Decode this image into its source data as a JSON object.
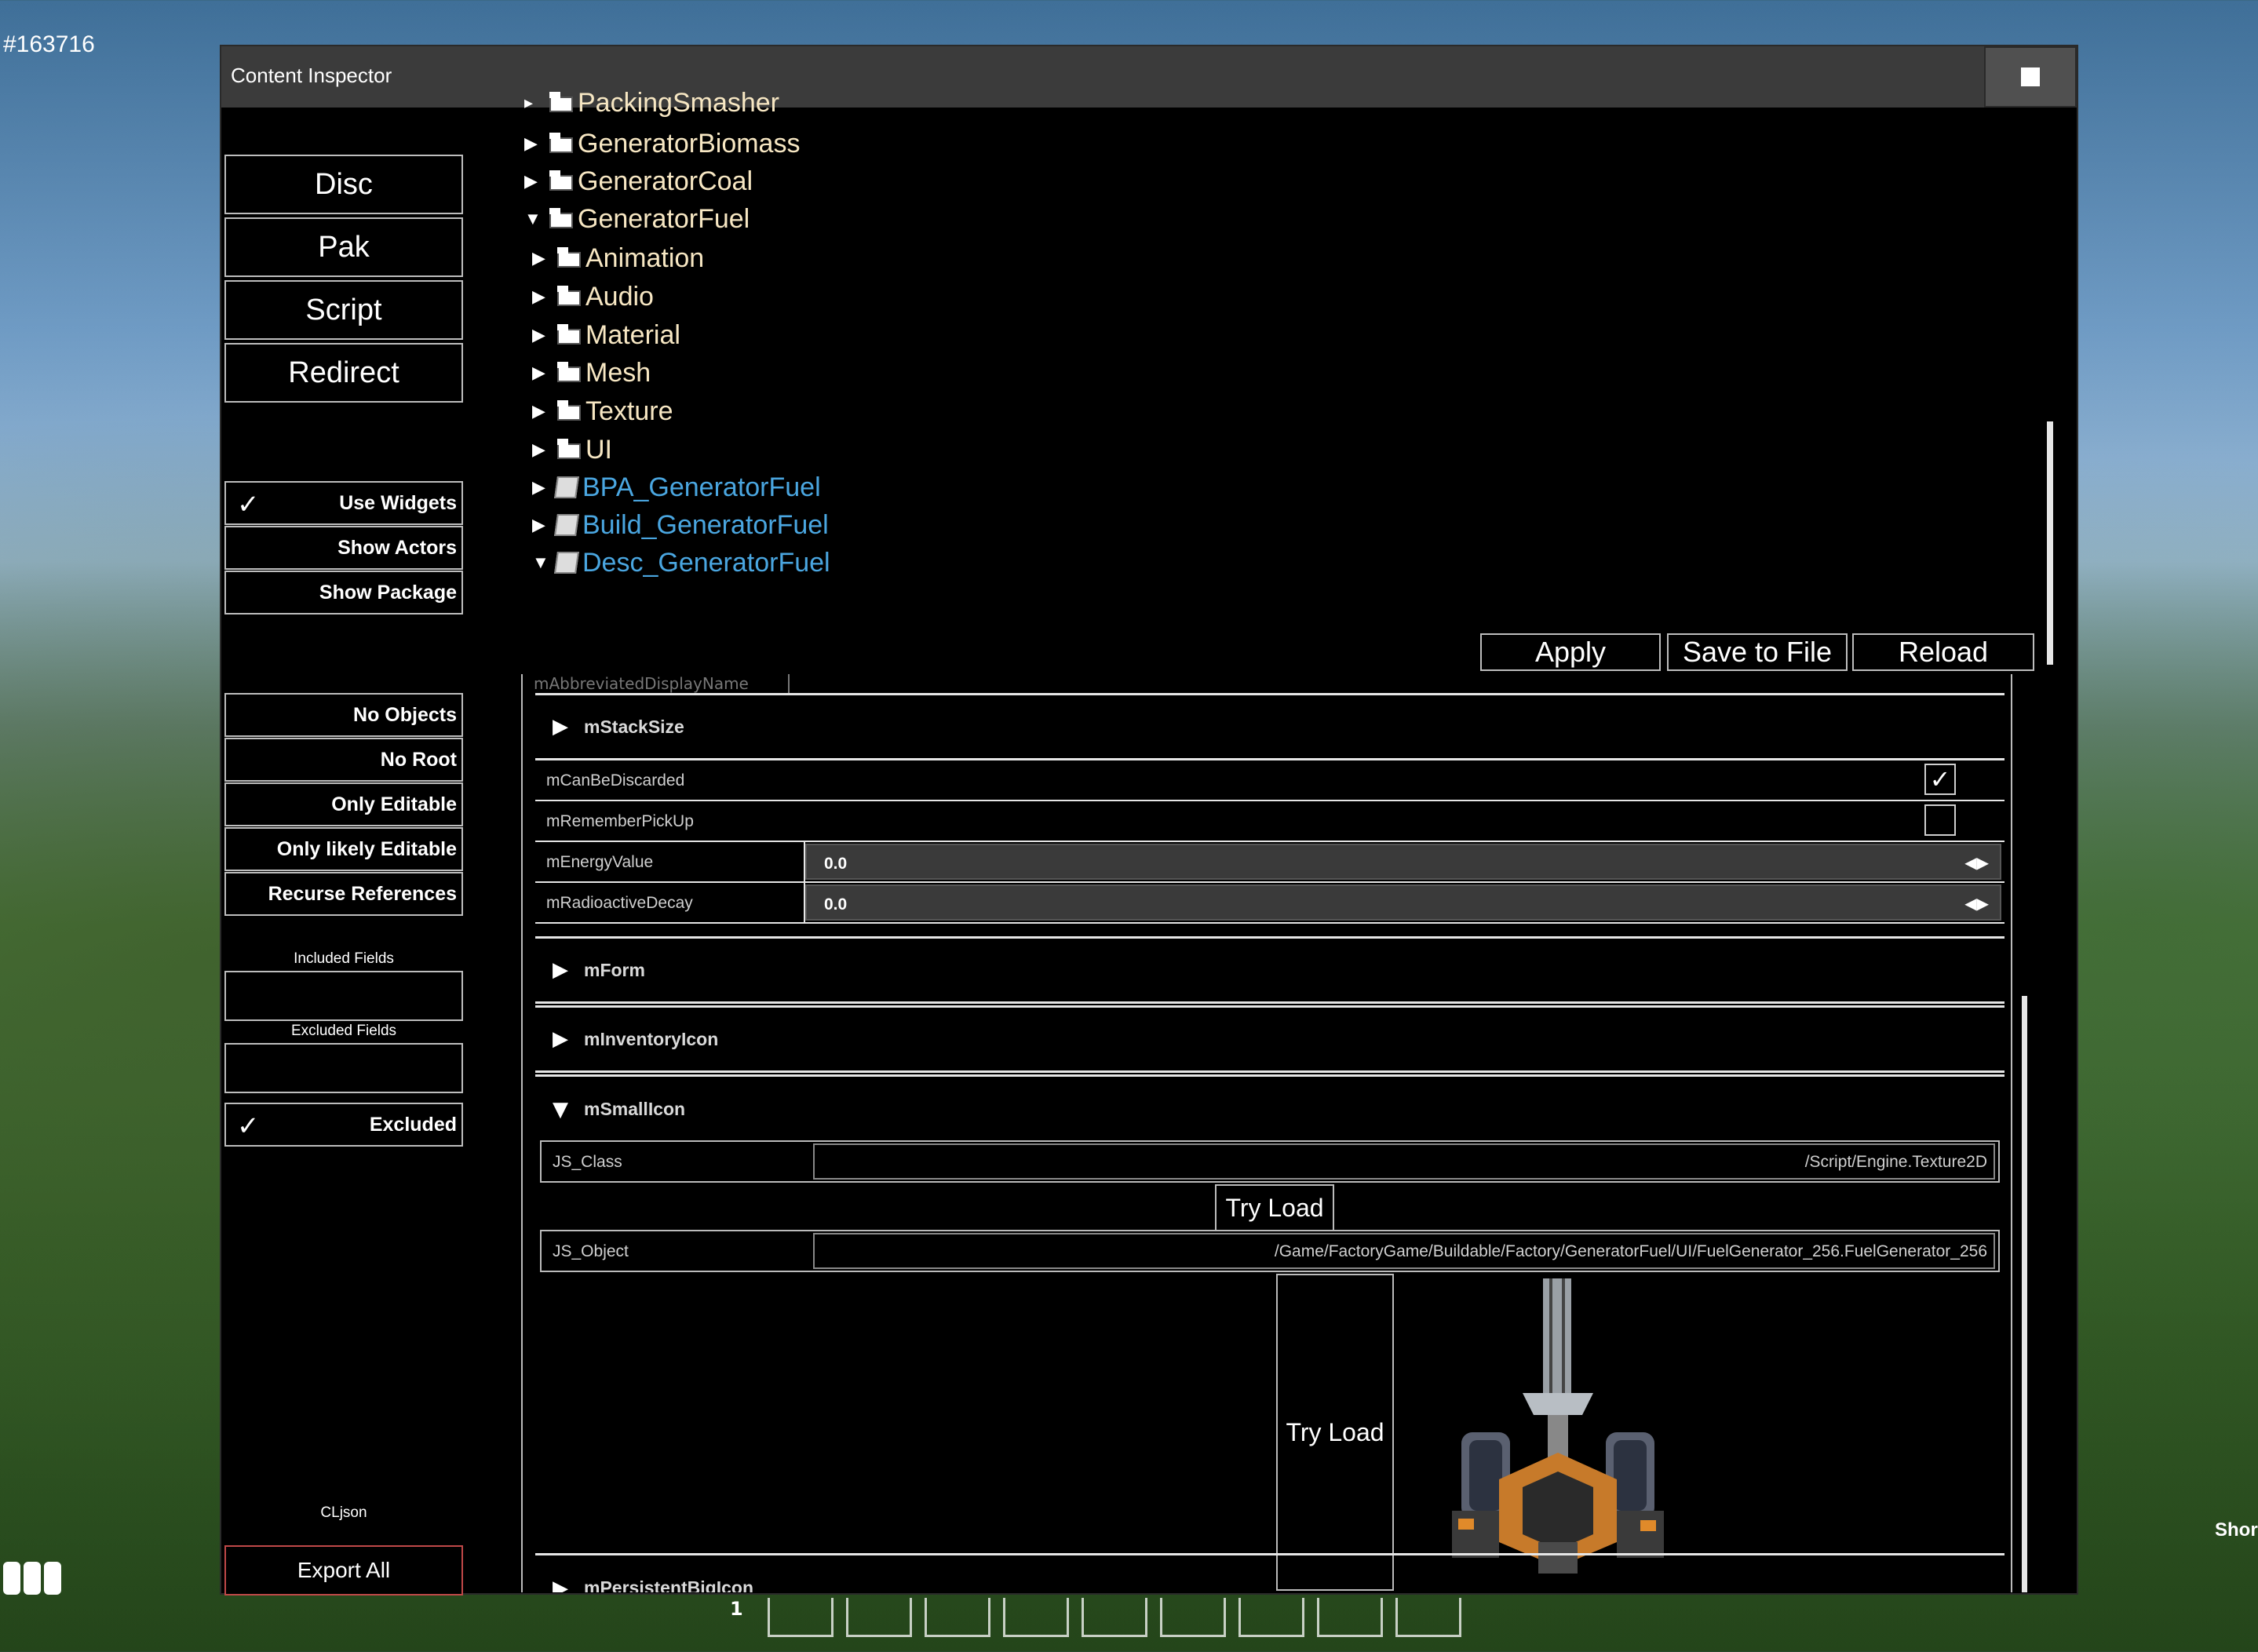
{
  "corner_id": "#163716",
  "window": {
    "title": "Content Inspector"
  },
  "sidebar": {
    "modes": [
      "Disc",
      "Pak",
      "Script",
      "Redirect"
    ],
    "toggles": [
      {
        "label": "Use Widgets",
        "checked": true
      },
      {
        "label": "Show Actors",
        "checked": false
      },
      {
        "label": "Show Package",
        "checked": false
      }
    ],
    "filters": [
      {
        "label": "No Objects"
      },
      {
        "label": "No Root"
      },
      {
        "label": "Only Editable"
      },
      {
        "label": "Only likely Editable"
      },
      {
        "label": "Recurse References"
      }
    ],
    "included_fields_label": "Included Fields",
    "excluded_fields_label": "Excluded Fields",
    "excluded_toggle": {
      "label": "Excluded",
      "checked": true
    },
    "format_label": "CLjson",
    "export_label": "Export All"
  },
  "tree": {
    "cut_item": "PackingSmasher",
    "items": [
      {
        "name": "GeneratorBiomass",
        "type": "folder",
        "expanded": false
      },
      {
        "name": "GeneratorCoal",
        "type": "folder",
        "expanded": false
      },
      {
        "name": "GeneratorFuel",
        "type": "folder",
        "expanded": true
      },
      {
        "name": "Animation",
        "type": "folder",
        "expanded": false
      },
      {
        "name": "Audio",
        "type": "folder",
        "expanded": false
      },
      {
        "name": "Material",
        "type": "folder",
        "expanded": false
      },
      {
        "name": "Mesh",
        "type": "folder",
        "expanded": false
      },
      {
        "name": "Texture",
        "type": "folder",
        "expanded": false
      },
      {
        "name": "UI",
        "type": "folder",
        "expanded": false
      },
      {
        "name": "BPA_GeneratorFuel",
        "type": "asset",
        "expanded": false
      },
      {
        "name": "Build_GeneratorFuel",
        "type": "asset",
        "expanded": false
      },
      {
        "name": "Desc_GeneratorFuel",
        "type": "asset",
        "expanded": true
      }
    ]
  },
  "actions": {
    "apply": "Apply",
    "save": "Save to File",
    "reload": "Reload"
  },
  "props": {
    "cut_row": "mAbbreviatedDisplayName",
    "stack_size": "mStackSize",
    "can_be_discarded": {
      "name": "mCanBeDiscarded",
      "checked": true
    },
    "remember_pickup": {
      "name": "mRememberPickUp",
      "checked": false
    },
    "energy_value": {
      "name": "mEnergyValue",
      "value": "0.0"
    },
    "radioactive_decay": {
      "name": "mRadioactiveDecay",
      "value": "0.0"
    },
    "form": "mForm",
    "inventory_icon": "mInventoryIcon",
    "small_icon": "mSmallIcon",
    "js_class": {
      "name": "JS_Class",
      "value": "/Script/Engine.Texture2D"
    },
    "try_load": "Try Load",
    "js_object": {
      "name": "JS_Object",
      "value": "/Game/FactoryGame/Buildable/Factory/GeneratorFuel/UI/FuelGenerator_256.FuelGenerator_256"
    },
    "try_load_2": "Try Load",
    "persistent_big_icon": "mPersistentBigIcon"
  },
  "hud": {
    "shortcut_label": "Short",
    "hotbar_number": "1"
  },
  "colors": {
    "folder_text": "#f7e7c3",
    "asset_text": "#4aa6e0",
    "export_border": "#c04848"
  }
}
